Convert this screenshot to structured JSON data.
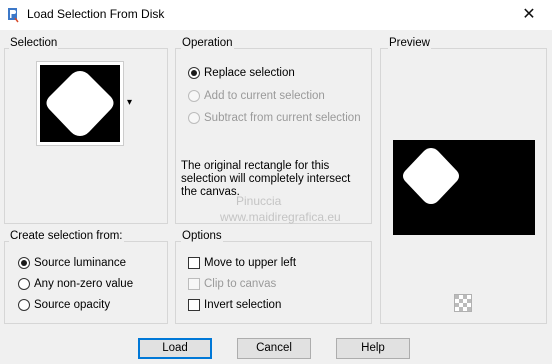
{
  "window": {
    "title": "Load Selection From Disk",
    "close_glyph": "✕"
  },
  "selection": {
    "label": "Selection",
    "dropdown_glyph": "▾"
  },
  "operation": {
    "label": "Operation",
    "options": [
      {
        "label": "Replace selection",
        "checked": true,
        "disabled": false
      },
      {
        "label": "Add to current selection",
        "checked": false,
        "disabled": true
      },
      {
        "label": "Subtract from current selection",
        "checked": false,
        "disabled": true
      }
    ],
    "info": "The original rectangle for this selection will completely intersect the canvas."
  },
  "preview": {
    "label": "Preview"
  },
  "create_from": {
    "label": "Create selection from:",
    "options": [
      {
        "label": "Source luminance",
        "checked": true
      },
      {
        "label": "Any non-zero value",
        "checked": false
      },
      {
        "label": "Source opacity",
        "checked": false
      }
    ]
  },
  "options": {
    "label": "Options",
    "items": [
      {
        "label": "Move to upper left",
        "checked": false,
        "disabled": false
      },
      {
        "label": "Clip to canvas",
        "checked": false,
        "disabled": true
      },
      {
        "label": "Invert selection",
        "checked": false,
        "disabled": false
      }
    ]
  },
  "buttons": {
    "load": "Load",
    "cancel": "Cancel",
    "help": "Help"
  },
  "watermark": {
    "line1": "Pinuccia",
    "line2": "www.maidiregrafica.eu"
  }
}
